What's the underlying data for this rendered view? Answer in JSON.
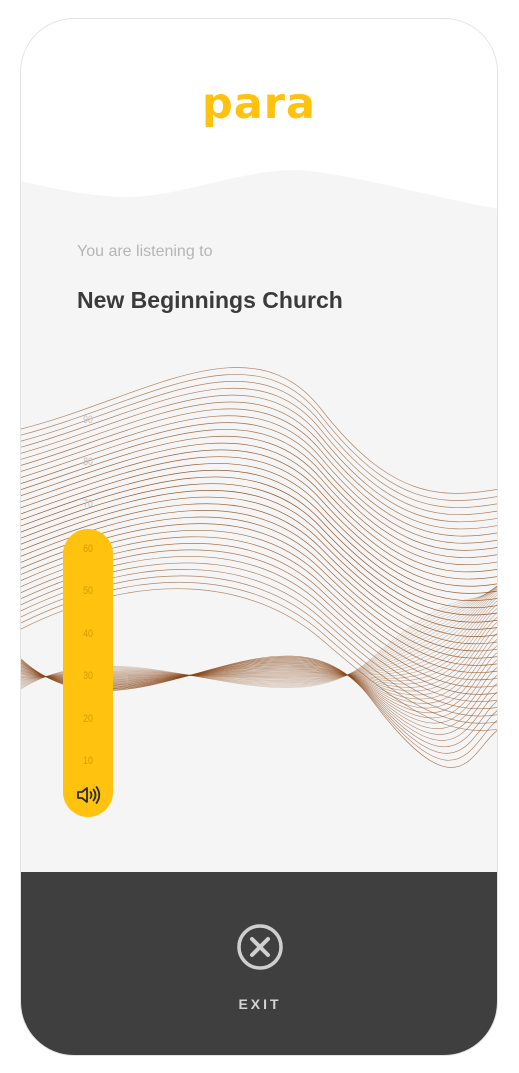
{
  "app": {
    "logo": "para"
  },
  "main": {
    "listening_label": "You are listening to",
    "church_name": "New Beginnings Church"
  },
  "volume": {
    "ticks": [
      "90",
      "80",
      "70",
      "60",
      "50",
      "40",
      "30",
      "20",
      "10"
    ],
    "level": 60,
    "icon": "speaker-volume-icon"
  },
  "footer": {
    "exit_label": "EXIT",
    "exit_icon": "close-circle-icon"
  },
  "colors": {
    "accent": "#ffc20e",
    "wave": "#8a4a1c",
    "footer_bg": "#3f3f3f",
    "page_bg": "#f5f5f5"
  }
}
